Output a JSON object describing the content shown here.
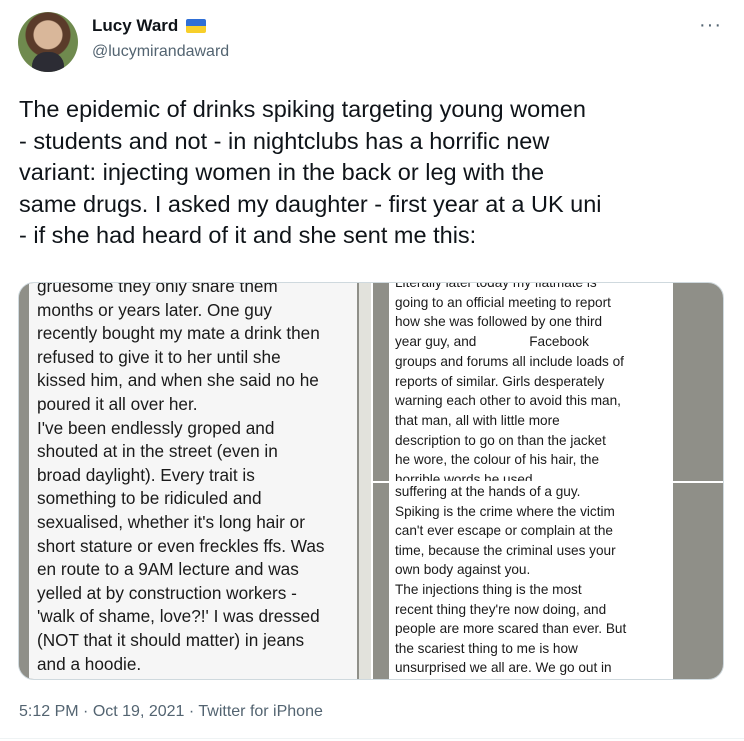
{
  "author": {
    "name": "Lucy Ward",
    "handle": "@lucymirandaward",
    "flag_icon": "ukraine-flag-icon",
    "flag_colors": [
      "#2f6fd6",
      "#f7cf2a"
    ]
  },
  "more_label": "···",
  "tweet": {
    "text": "The epidemic of drinks spiking targeting young women\n- students and not - in nightclubs has a horrific new\nvariant: injecting women in the back or leg with the\nsame drugs. I asked my daughter - first year at a UK uni\n- if she had heard of it and she sent me this:"
  },
  "media": {
    "left_screenshot_text": "gruesome they only share them\nmonths or years later. One guy\nrecently bought my mate a drink then\nrefused to give it to her until she\nkissed him, and when she said no he\npoured it all over her.\nI've been endlessly groped and\nshouted at in the street (even in\nbroad daylight). Every trait is\nsomething to be ridiculed and\nsexualised, whether it's long hair or\nshort stature or even freckles ffs. Was\nen route to a 9AM lecture and was\nyelled at by construction workers -\n'walk of shame, love?!' I was dressed\n(NOT that it should matter) in jeans\nand a hoodie.",
    "top_right_screenshot_text": "Literally later today my flatmate is\ngoing to an official meeting to report\nhow she was followed by one third\nyear guy, and              Facebook\ngroups and forums all include loads of\nreports of similar. Girls desperately\nwarning each other to avoid this man,\nthat man, all with little more\ndescription to go on than the jacket\nhe wore, the colour of his hair, the\nhorrible words he used",
    "bottom_right_screenshot_text": "suffering at the hands of a guy.\nSpiking is the crime where the victim\ncan't ever escape or complain at the\ntime, because the criminal uses your\nown body against you.\nThe injections thing is the most\nrecent thing they're now doing, and\npeople are more scared than ever. But\nthe scariest thing to me is how\nunsurprised we all are. We go out in"
  },
  "meta": {
    "time": "5:12 PM",
    "sep1": " · ",
    "date": "Oct 19, 2021",
    "sep2": " · ",
    "source": "Twitter for iPhone"
  }
}
